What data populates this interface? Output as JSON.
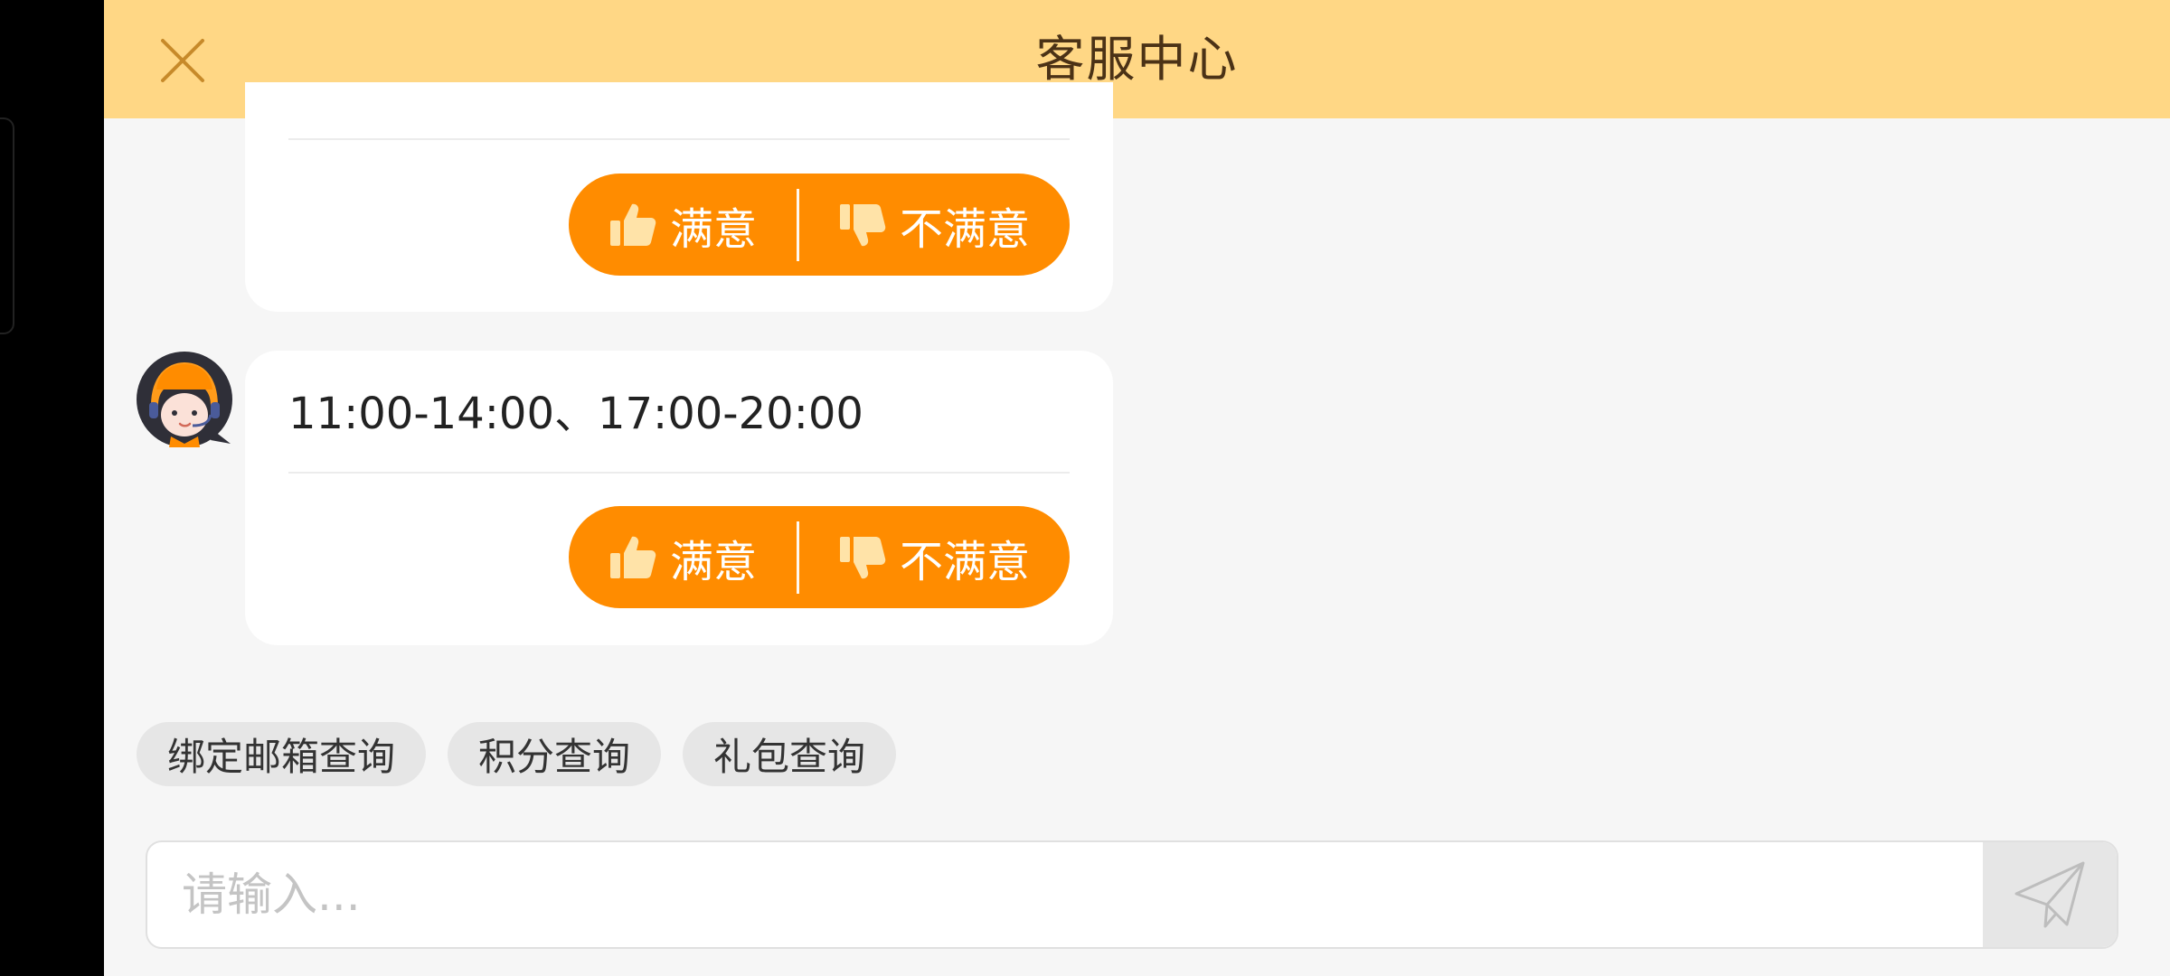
{
  "header": {
    "title": "客服中心",
    "close_icon": "close-icon"
  },
  "messages": [
    {
      "text": "",
      "rating": {
        "satisfied_label": "满意",
        "unsatisfied_label": "不满意"
      }
    },
    {
      "text": "11:00-14:00、17:00-20:00",
      "rating": {
        "satisfied_label": "满意",
        "unsatisfied_label": "不满意"
      }
    }
  ],
  "quick_replies": [
    "绑定邮箱查询",
    "积分查询",
    "礼包查询"
  ],
  "composer": {
    "placeholder": "请输入...",
    "send_icon": "send-icon"
  },
  "colors": {
    "header_bg": "#ffd785",
    "accent": "#ff8c00",
    "page_bg": "#f6f6f6",
    "chip_bg": "#e6e6e6"
  }
}
